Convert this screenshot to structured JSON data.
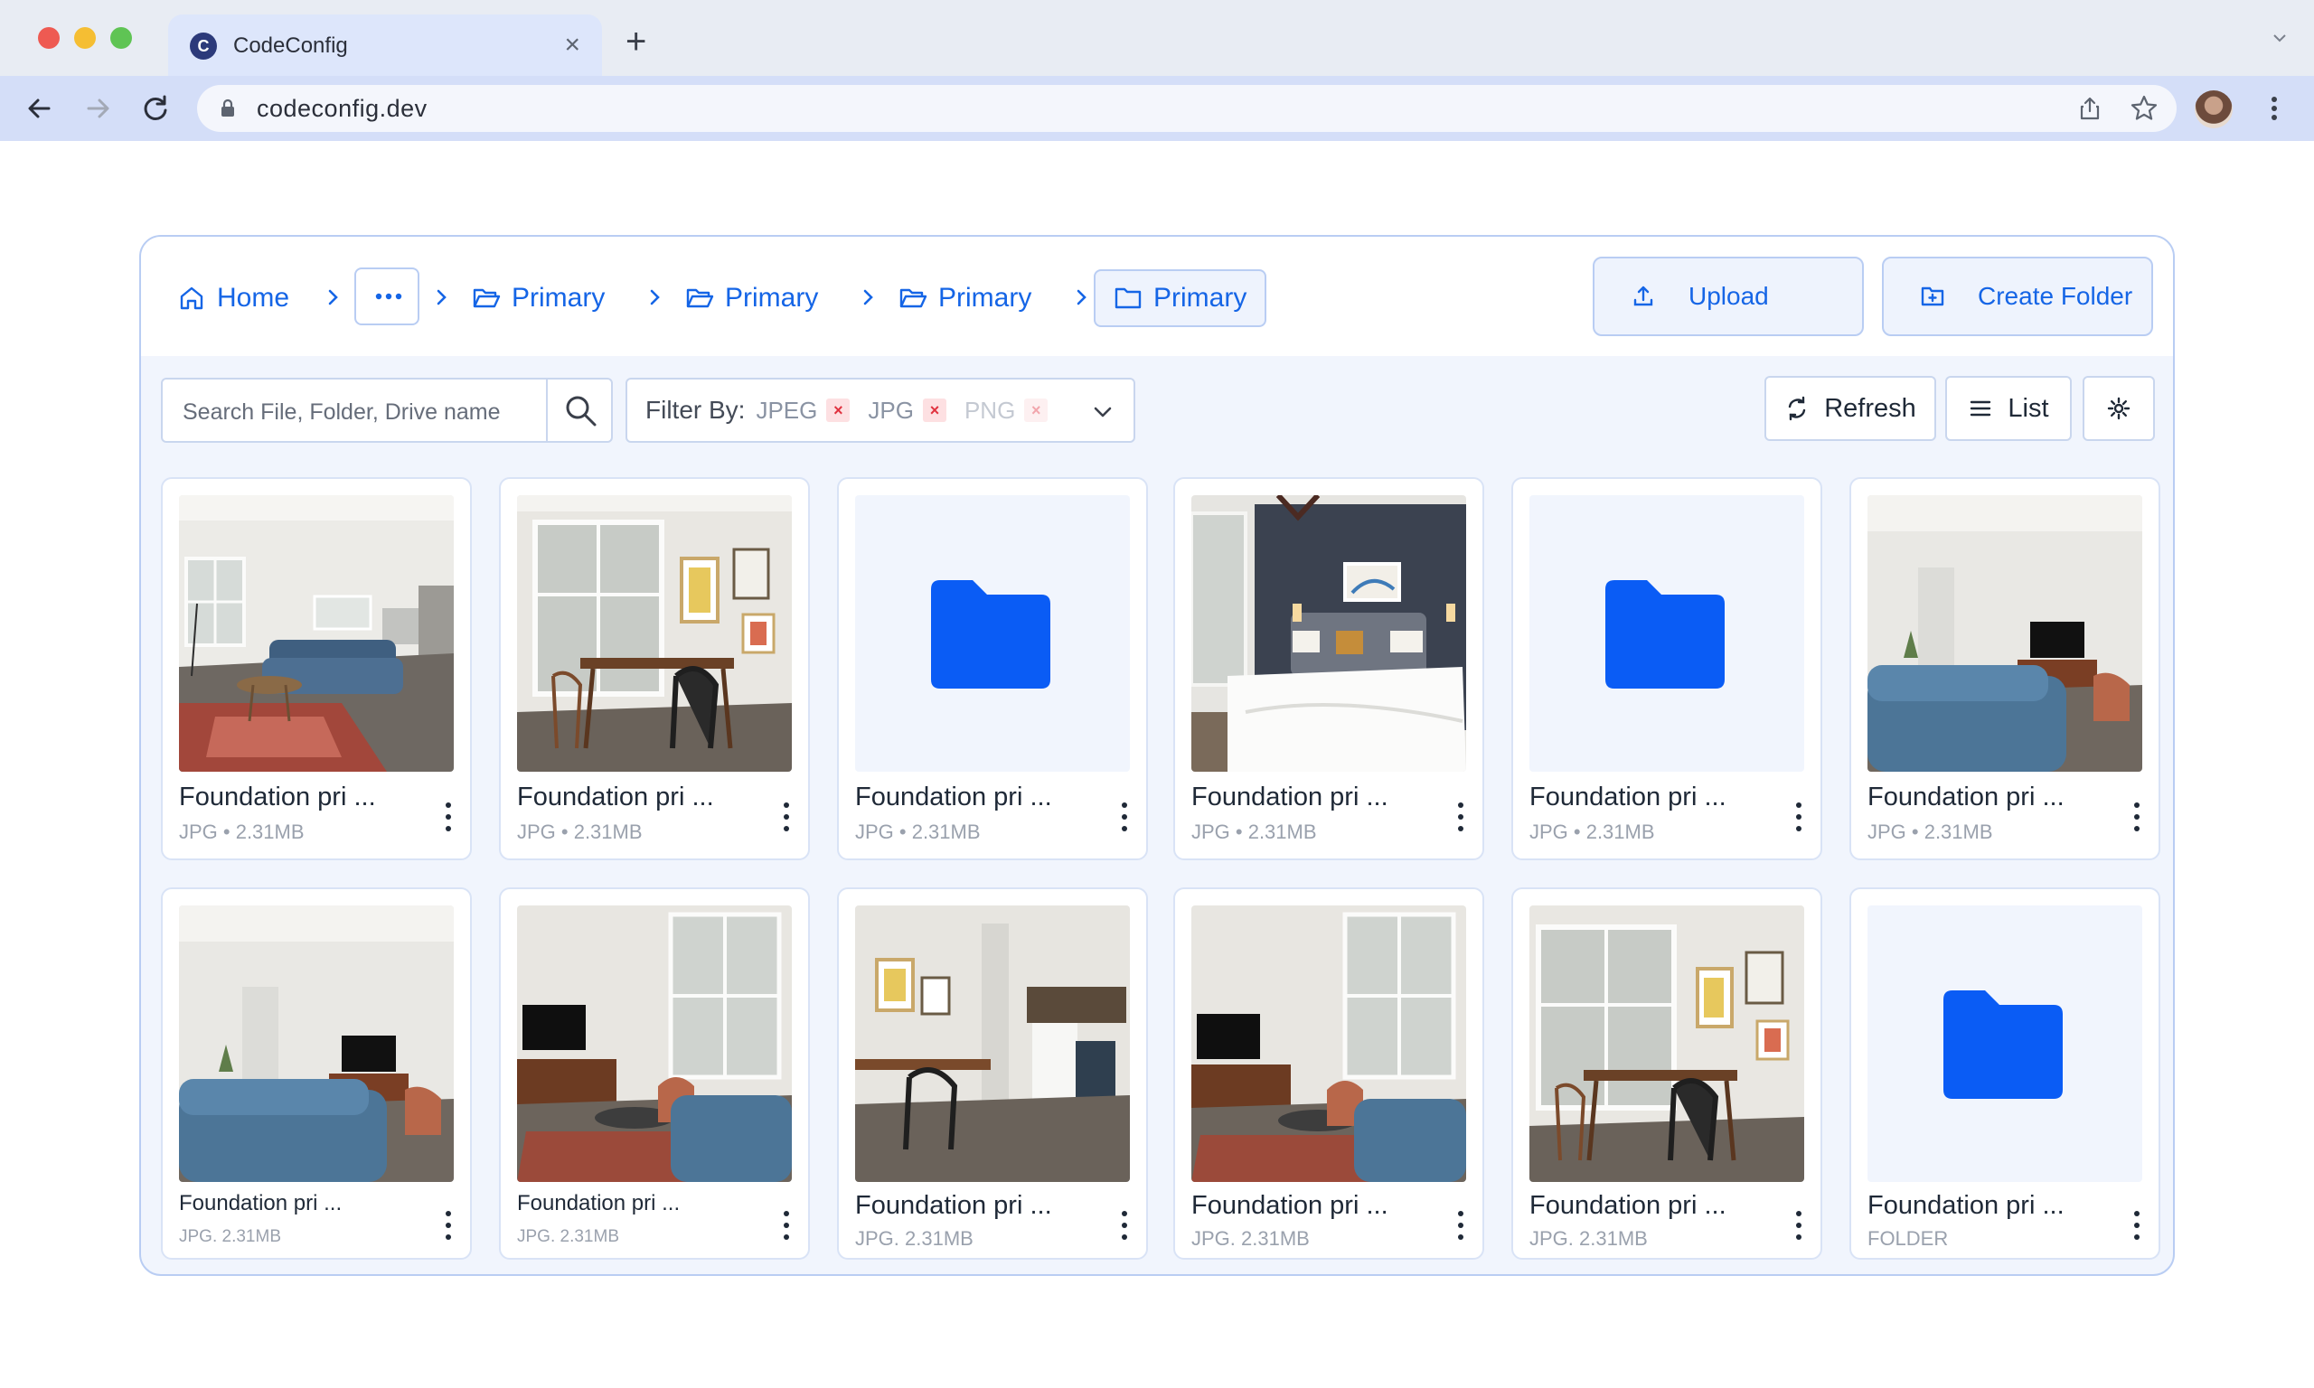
{
  "browser": {
    "tab_title": "CodeConfig",
    "favicon_letter": "C",
    "url": "codeconfig.dev"
  },
  "breadcrumb": {
    "home": "Home",
    "more": "...",
    "items": [
      "Primary",
      "Primary",
      "Primary",
      "Primary"
    ]
  },
  "actions": {
    "upload": "Upload",
    "create_folder": "Create Folder"
  },
  "search": {
    "placeholder": "Search File, Folder, Drive name"
  },
  "filter": {
    "label": "Filter By:",
    "chips": [
      "JPEG",
      "JPG",
      "PNG"
    ]
  },
  "tools": {
    "refresh": "Refresh",
    "list": "List"
  },
  "files": [
    {
      "name": "Foundation pri ...",
      "meta": "JPG • 2.31MB",
      "kind": "image"
    },
    {
      "name": "Foundation pri ...",
      "meta": "JPG • 2.31MB",
      "kind": "image"
    },
    {
      "name": "Foundation pri ...",
      "meta": "JPG • 2.31MB",
      "kind": "folder"
    },
    {
      "name": "Foundation pri ...",
      "meta": "JPG • 2.31MB",
      "kind": "image"
    },
    {
      "name": "Foundation pri ...",
      "meta": "JPG • 2.31MB",
      "kind": "folder"
    },
    {
      "name": "Foundation pri ...",
      "meta": "JPG • 2.31MB",
      "kind": "image"
    },
    {
      "name": "Foundation pri ...",
      "meta": "JPG. 2.31MB",
      "kind": "image"
    },
    {
      "name": "Foundation pri ...",
      "meta": "JPG. 2.31MB",
      "kind": "image"
    },
    {
      "name": "Foundation pri ...",
      "meta": "JPG. 2.31MB",
      "kind": "image"
    },
    {
      "name": "Foundation pri ...",
      "meta": "JPG. 2.31MB",
      "kind": "image"
    },
    {
      "name": "Foundation pri ...",
      "meta": "JPG. 2.31MB",
      "kind": "image"
    },
    {
      "name": "Foundation pri ...",
      "meta": "FOLDER",
      "kind": "folder"
    }
  ],
  "colors": {
    "accent": "#1565e6",
    "folder": "#0a5cf5",
    "panel_bg": "#f1f5fd",
    "border": "#b9cdf3",
    "chip_remove": "#e0323f"
  }
}
